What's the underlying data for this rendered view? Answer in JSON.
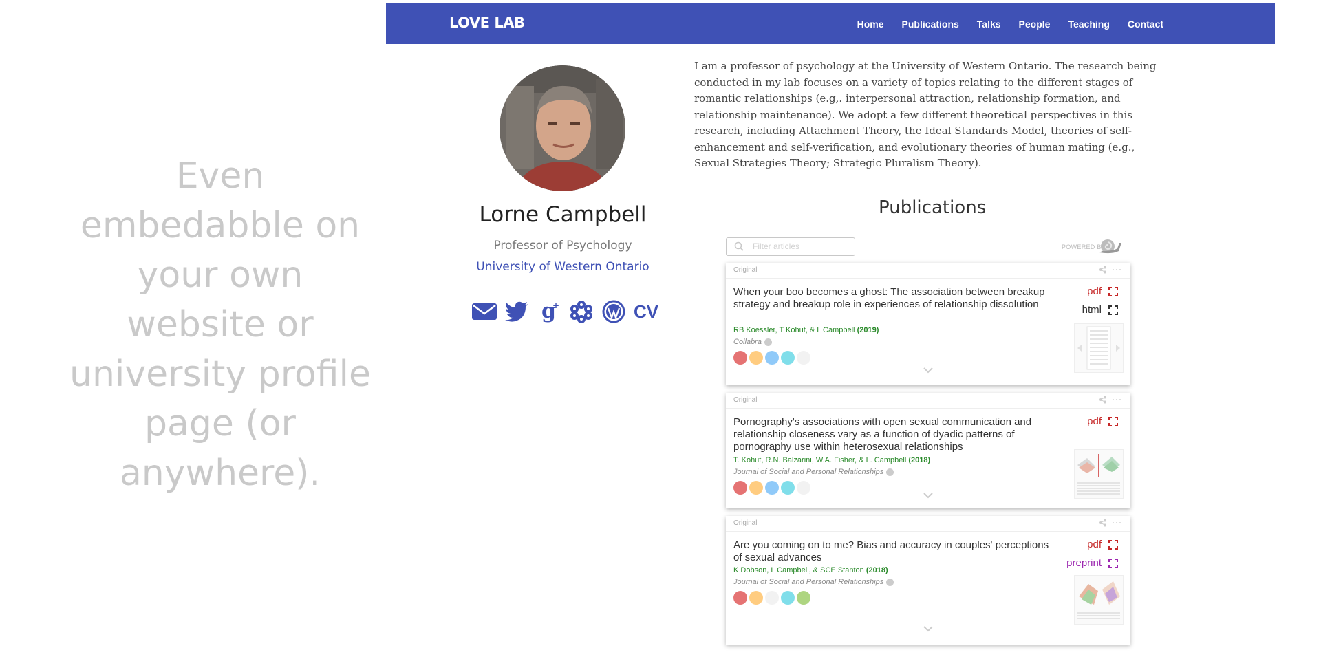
{
  "promo": {
    "text": "Even embedabble on your own website or university profile page (or anywhere)."
  },
  "navbar": {
    "brand": "LOVE LAB",
    "items": [
      "Home",
      "Publications",
      "Talks",
      "People",
      "Teaching",
      "Contact"
    ]
  },
  "profile": {
    "name": "Lorne Campbell",
    "title": "Professor of Psychology",
    "university": "University of Western Ontario",
    "cv_label": "CV",
    "icons": [
      "email-icon",
      "twitter-icon",
      "google-scholar-icon",
      "researchgate-icon",
      "wordpress-icon"
    ]
  },
  "bio": "I am a professor of psychology at the University of Western Ontario. The research being conducted in my lab focuses on a variety of topics relating to the different stages of romantic relationships (e.g,. interpersonal attraction, relationship formation, and relationship maintenance). We adopt a few different theoretical perspectives in this research, including Attachment Theory, the Ideal Standards Model, theories of self-enhancement and self-verification, and evolutionary theories of human mating (e.g., Sexual Strategies Theory; Strategic Pluralism Theory).",
  "publications": {
    "heading": "Publications",
    "filter_placeholder": "Filter articles",
    "powered_by": "POWERED BY",
    "items": [
      {
        "tag": "Original",
        "title": "When your boo becomes a ghost: The association between breakup strategy and breakup role in experiences of relationship dissolution",
        "authors": "RB Koessler, T Kohut, & L Campbell",
        "year": "(2019)",
        "journal": "Collabra",
        "links": [
          "pdf",
          "html"
        ]
      },
      {
        "tag": "Original",
        "title": "Pornography's associations with open sexual communication and relationship closeness vary as a function of dyadic patterns of pornography use within heterosexual relationships",
        "authors": "T. Kohut, R.N. Balzarini, W.A. Fisher, & L. Campbell",
        "year": "(2018)",
        "journal": "Journal of Social and Personal Relationships",
        "links": [
          "pdf"
        ]
      },
      {
        "tag": "Original",
        "title": "Are you coming on to me? Bias and accuracy in couples' perceptions of sexual advances",
        "authors": "K Dobson, L Campbell, & SCE Stanton",
        "year": "(2018)",
        "journal": "Journal of Social and Personal Relationships",
        "links": [
          "pdf",
          "preprint"
        ]
      }
    ]
  },
  "colors": {
    "navbar": "#3f51b5",
    "link": "#3f51b5",
    "pdf": "#c62828",
    "preprint": "#9c27b0",
    "authors": "#2a8a2a"
  }
}
